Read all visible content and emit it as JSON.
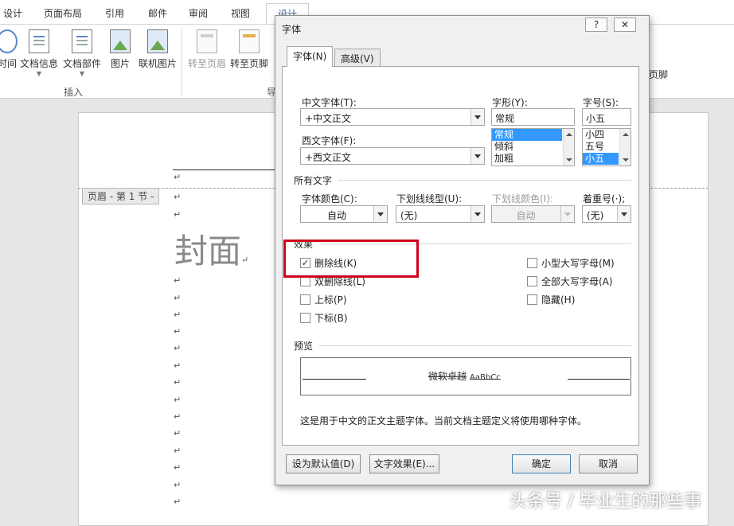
{
  "ribbon": {
    "tabs": [
      "设计",
      "页面布局",
      "引用",
      "邮件",
      "审阅",
      "视图",
      "设计"
    ],
    "buttons": {
      "time": "时间",
      "doc_info": "文档信息",
      "doc_parts": "文档部件",
      "picture": "图片",
      "online_picture": "联机图片",
      "goto_header": "转至页眉",
      "goto_footer": "转至页脚",
      "footer_partial": "页脚",
      "cut_label": "导"
    },
    "group_insert": "插入"
  },
  "document": {
    "header_tag": "页眉 - 第 1 节 -",
    "cover_text": "封面",
    "para_mark": "↵"
  },
  "dialog": {
    "title": "字体",
    "help": "?",
    "close": "✕",
    "tabs": {
      "font": "字体(N)",
      "advanced": "高级(V)"
    },
    "chinese_font": {
      "label": "中文字体(T):",
      "value": "+中文正文"
    },
    "western_font": {
      "label": "西文字体(F):",
      "value": "+西文正文"
    },
    "style": {
      "label": "字形(Y):",
      "value": "常规",
      "options": [
        "常规",
        "倾斜",
        "加粗"
      ],
      "selected": "常规"
    },
    "size": {
      "label": "字号(S):",
      "value": "小五",
      "options": [
        "小四",
        "五号",
        "小五"
      ],
      "selected": "小五"
    },
    "all_text": {
      "heading": "所有文字",
      "font_color": {
        "label": "字体颜色(C):",
        "value": "自动"
      },
      "underline_style": {
        "label": "下划线线型(U):",
        "value": "(无)"
      },
      "underline_color": {
        "label": "下划线颜色(I):",
        "value": "自动"
      },
      "emphasis": {
        "label": "着重号(·);",
        "value": "(无)"
      }
    },
    "effects": {
      "heading": "效果",
      "strikethrough": {
        "label": "删除线(K)",
        "checked": true
      },
      "double_strikethrough": {
        "label": "双删除线(L)",
        "checked": false
      },
      "superscript": {
        "label": "上标(P)",
        "checked": false
      },
      "subscript": {
        "label": "下标(B)",
        "checked": false
      },
      "small_caps": {
        "label": "小型大写字母(M)",
        "checked": false
      },
      "all_caps": {
        "label": "全部大写字母(A)",
        "checked": false
      },
      "hidden": {
        "label": "隐藏(H)",
        "checked": false
      }
    },
    "preview": {
      "heading": "预览",
      "sample_cn": "微软卓越",
      "sample_latin": "AaBbCc",
      "description": "这是用于中文的正文主题字体。当前文档主题定义将使用哪种字体。"
    },
    "buttons": {
      "set_default": "设为默认值(D)",
      "text_effects": "文字效果(E)...",
      "ok": "确定",
      "cancel": "取消"
    }
  },
  "watermark": "头条号 / 毕业生的那些事",
  "colors": {
    "highlight": "#d0021b",
    "selection": "#3399ff",
    "ribbon_accent": "#2b579a"
  }
}
